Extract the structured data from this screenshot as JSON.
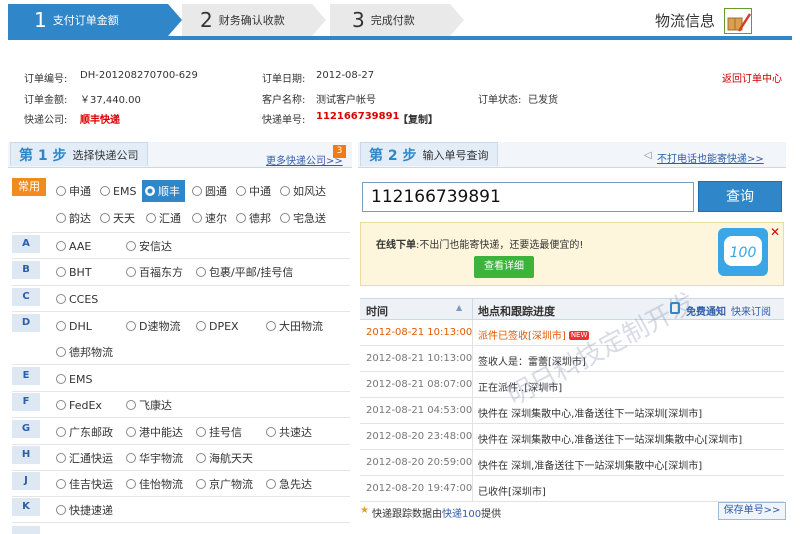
{
  "steps": [
    {
      "num": "1",
      "label": "支付订单金额"
    },
    {
      "num": "2",
      "label": "财务确认收款"
    },
    {
      "num": "3",
      "label": "完成付款"
    }
  ],
  "logistics_title": "物流信息",
  "order": {
    "no_label": "订单编号:",
    "no": "DH-201208270700-629",
    "date_label": "订单日期:",
    "date": "2012-08-27",
    "back_link": "返回订单中心",
    "amount_label": "订单金额:",
    "amount": "￥37,440.00",
    "customer_label": "客户名称:",
    "customer": "测试客户帐号",
    "status_label": "订单状态:",
    "status": "已发货",
    "company_label": "快递公司:",
    "company": "顺丰快递",
    "waybill_label": "快递单号:",
    "waybill": "112166739891",
    "copy": "【复制】"
  },
  "step1": {
    "num": "第 1 步",
    "title": "选择快递公司",
    "more": "更多快递公司>>",
    "more_badge": "3"
  },
  "step2": {
    "num": "第 2 步",
    "title": "输入单号查询",
    "no_call": "不打电话也能寄快递>>"
  },
  "common_label": "常用",
  "common_row1": [
    "申通",
    "EMS",
    "顺丰",
    "圆通",
    "中通",
    "如风达"
  ],
  "common_row2": [
    "韵达",
    "天天",
    "汇通",
    "速尔",
    "德邦",
    "宅急送"
  ],
  "letters": {
    "A": [
      "AAE",
      "安信达"
    ],
    "B": [
      "BHT",
      "百福东方",
      "包裹/平邮/挂号信"
    ],
    "C": [
      "CCES"
    ],
    "D1": [
      "DHL",
      "D速物流",
      "DPEX",
      "大田物流"
    ],
    "D2": [
      "德邦物流"
    ],
    "E": [
      "EMS"
    ],
    "F": [
      "FedEx",
      "飞康达"
    ],
    "G": [
      "广东邮政",
      "港中能达",
      "挂号信",
      "共速达"
    ],
    "H": [
      "汇通快运",
      "华宇物流",
      "海航天天"
    ],
    "J": [
      "佳吉快运",
      "佳怡物流",
      "京广物流",
      "急先达"
    ],
    "K": [
      "快捷速递"
    ]
  },
  "query": {
    "value": "112166739891",
    "button": "查询"
  },
  "ad": {
    "title": "在线下单",
    "text": ":不出门也能寄快递，还要选最便宜的!",
    "button": "查看详细"
  },
  "track": {
    "col_time": "时间",
    "col_desc": "地点和跟踪进度",
    "notify": "免费通知",
    "subscribe": "快来订阅",
    "rows": [
      {
        "time": "2012-08-21 10:13:00",
        "desc": "派件已签收[深圳市]",
        "new": "NEW"
      },
      {
        "time": "2012-08-21 10:13:00",
        "desc": "签收人是：雷蕾[深圳市]"
      },
      {
        "time": "2012-08-21 08:07:00",
        "desc": "正在派件..[深圳市]"
      },
      {
        "time": "2012-08-21 04:53:00",
        "desc": "快件在 深圳集散中心,准备送往下一站深圳[深圳市]"
      },
      {
        "time": "2012-08-20 23:48:00",
        "desc": "快件在 深圳集散中心,准备送往下一站深圳集散中心[深圳市]"
      },
      {
        "time": "2012-08-20 20:59:00",
        "desc": "快件在 深圳,准备送往下一站深圳集散中心[深圳市]"
      },
      {
        "time": "2012-08-20 19:47:00",
        "desc": "已收件[深圳市]"
      }
    ],
    "source_prefix": "快递跟踪数据由",
    "source_link": "快递100",
    "source_suffix": "提供",
    "save": "保存单号>>"
  },
  "watermark": "明日科技定制开发",
  "colors": {
    "accent": "#2f86c9",
    "highlight": "#e05a00",
    "danger": "#d00000"
  }
}
